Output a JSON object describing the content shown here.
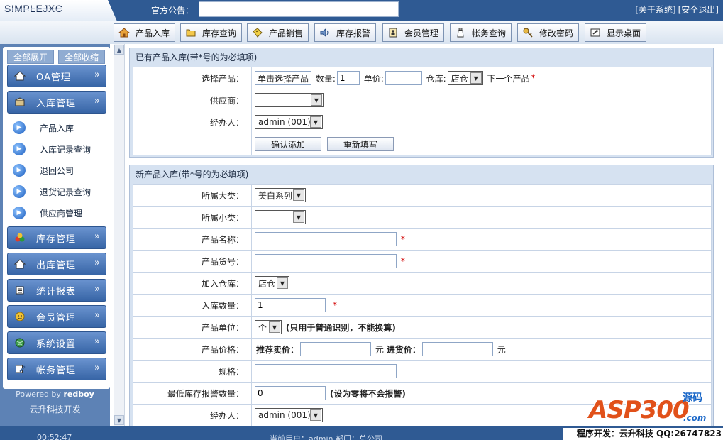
{
  "header": {
    "logo": "SIMPLEJXC",
    "notice_label": "官方公告：",
    "links": [
      "[关于系统]",
      "[安全退出]"
    ]
  },
  "tabs": [
    {
      "label": "产品入库",
      "icon": "home-icon"
    },
    {
      "label": "库存查询",
      "icon": "folder-icon"
    },
    {
      "label": "产品销售",
      "icon": "tag-icon"
    },
    {
      "label": "库存报警",
      "icon": "speaker-icon"
    },
    {
      "label": "会员管理",
      "icon": "member-card-icon"
    },
    {
      "label": "帐务查询",
      "icon": "bottle-icon"
    },
    {
      "label": "修改密码",
      "icon": "key-icon"
    },
    {
      "label": "显示桌面",
      "icon": "desktop-icon"
    }
  ],
  "sidebar": {
    "expand_all": "全部展开",
    "collapse_all": "全部收缩",
    "menus": [
      {
        "label": "OA管理",
        "icon": "home-icon"
      },
      {
        "label": "入库管理",
        "icon": "box-icon"
      }
    ],
    "subitems": [
      "产品入库",
      "入库记录查询",
      "退回公司",
      "退货记录查询",
      "供应商管理"
    ],
    "menus_after": [
      {
        "label": "库存管理",
        "icon": "colorful-dots-icon"
      },
      {
        "label": "出库管理",
        "icon": "home-icon"
      },
      {
        "label": "统计报表",
        "icon": "report-icon"
      },
      {
        "label": "会员管理",
        "icon": "member-icon"
      },
      {
        "label": "系统设置",
        "icon": "globe-icon"
      },
      {
        "label": "帐务管理",
        "icon": "edit-icon"
      }
    ],
    "arrow": "»",
    "powered_prefix": "Powered by ",
    "powered_name": "redboy",
    "company": "云升科技开发"
  },
  "existing_panel": {
    "title": "已有产品入库(带*号的为必填项)",
    "product_label": "选择产品：",
    "product_button": "单击选择产品",
    "qty_label": "数量:",
    "qty_value": "1",
    "price_label": "单价:",
    "price_value": "",
    "warehouse_label": "仓库:",
    "warehouse_value": "店仓",
    "next_label": "下一个产品",
    "supplier_label": "供应商：",
    "supplier_value": "",
    "handler_label": "经办人：",
    "handler_value": "admin (001)",
    "confirm_button": "确认添加",
    "reset_button": "重新填写"
  },
  "new_panel": {
    "title": "新产品入库(带*号的为必填项)",
    "category_label": "所属大类：",
    "category_value": "美白系列",
    "subcategory_label": "所属小类：",
    "subcategory_value": "",
    "name_label": "产品名称：",
    "name_value": "",
    "code_label": "产品货号：",
    "code_value": "",
    "warehouse_label": "加入仓库：",
    "warehouse_value": "店仓",
    "qty_label": "入库数量：",
    "qty_value": "1",
    "unit_label": "产品单位：",
    "unit_value": "个",
    "unit_note": "(只用于普通识别，不能换算)",
    "price_label": "产品价格：",
    "sale_label": "推荐卖价：",
    "sale_value": "",
    "yuan": "元",
    "cost_label": "进货价：",
    "cost_value": "",
    "spec_label": "规格：",
    "spec_value": "",
    "min_label": "最低库存报警数量：",
    "min_value": "0",
    "min_note": "(设为零将不会报警)",
    "handler_label": "经办人：",
    "handler_value": "admin (001)"
  },
  "required_mark": "*",
  "statusbar": {
    "time": "00:52:47",
    "user_line": "当前用户：admin   部门：总公司",
    "dev_credit": "程序开发：云升科技  QQ:26747823"
  },
  "watermark": {
    "main": "ASP300",
    "cn": "源码",
    "com": ".com"
  }
}
